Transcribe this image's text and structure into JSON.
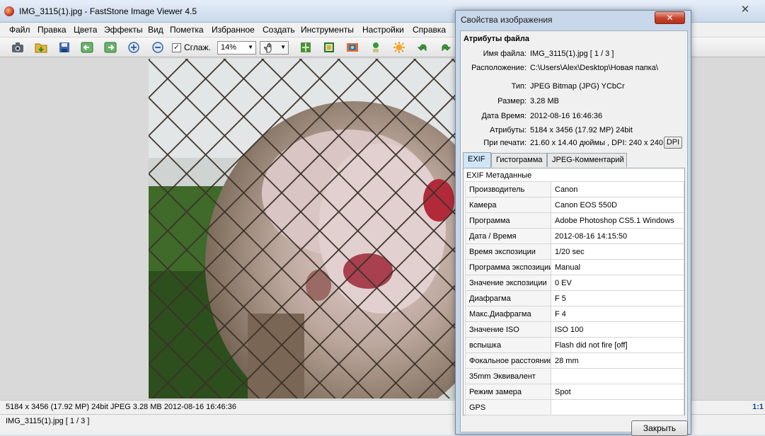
{
  "window": {
    "title": "IMG_3115(1).jpg  -  FastStone Image Viewer 4.5",
    "close_glyph": "✕"
  },
  "menu": [
    "Файл",
    "Правка",
    "Цвета",
    "Эффекты",
    "Вид",
    "Пометка",
    "Избранное",
    "Создать",
    "Инструменты",
    "Настройки",
    "Справка"
  ],
  "toolbar": {
    "smooth_label": "Сглаж.",
    "smooth_checked": true,
    "zoom_value": "14%",
    "icons": [
      "camera-icon",
      "open-folder-icon",
      "save-icon",
      "prev-icon",
      "next-icon",
      "zoom-in-icon",
      "zoom-out-icon",
      "hand-tool-icon",
      "slideshow-icon",
      "crop-icon",
      "resize-icon",
      "color-adjust-icon",
      "brightness-icon",
      "rotate-left-icon",
      "rotate-right-icon"
    ]
  },
  "status": {
    "info": "5184 x 3456 (17.92 MP)  24bit  JPEG   3.28 MB   2012-08-16 16:46:36",
    "file": "IMG_3115(1).jpg [ 1 / 3 ]",
    "zoom_readout": "1:1"
  },
  "dialog": {
    "title": "Свойства изображения",
    "close_glyph": "✕",
    "group_title": "Атрибуты файла",
    "props": [
      {
        "label": "Имя файла:",
        "value": "IMG_3115(1).jpg   [ 1 / 3 ]"
      },
      {
        "label": "Расположение:",
        "value": "C:\\Users\\Alex\\Desktop\\Новая папка\\"
      },
      {
        "label": "Тип:",
        "value": "JPEG Bitmap (JPG) YCbCr"
      },
      {
        "label": "Размер:",
        "value": "3.28 MB"
      },
      {
        "label": "Дата Время:",
        "value": "2012-08-16 16:46:36"
      },
      {
        "label": "Атрибуты:",
        "value": "5184 x 3456 (17.92 MP)  24bit"
      },
      {
        "label": "При печати:",
        "value": "21.60 x 14.40 дюймы ,   DPI: 240 x 240"
      }
    ],
    "dpi_button": "DPI",
    "tabs": [
      "EXIF",
      "Гистограмма",
      "JPEG-Комментарий"
    ],
    "exif_header": "EXIF Метаданные",
    "exif": [
      [
        "Производитель",
        "Canon"
      ],
      [
        "Камера",
        "Canon EOS 550D"
      ],
      [
        "Программа",
        "Adobe Photoshop CS5.1 Windows"
      ],
      [
        "Дата / Время",
        "2012-08-16 14:15:50"
      ],
      [
        "Время экспозиции",
        "1/20 sec"
      ],
      [
        "Программа экспозиции",
        "Manual"
      ],
      [
        "Значение экспозиции",
        "0 EV"
      ],
      [
        "Диафрагма",
        "F 5"
      ],
      [
        "Макс.Диафрагма",
        "F 4"
      ],
      [
        "Значение ISO",
        "ISO 100"
      ],
      [
        "вспышка",
        "Flash did not fire [off]"
      ],
      [
        "Фокальное расстояние",
        "28 mm"
      ],
      [
        "35mm Эквивалент",
        ""
      ],
      [
        "Режим замера",
        "Spot"
      ],
      [
        "GPS",
        ""
      ]
    ],
    "close_button": "Закрыть"
  }
}
